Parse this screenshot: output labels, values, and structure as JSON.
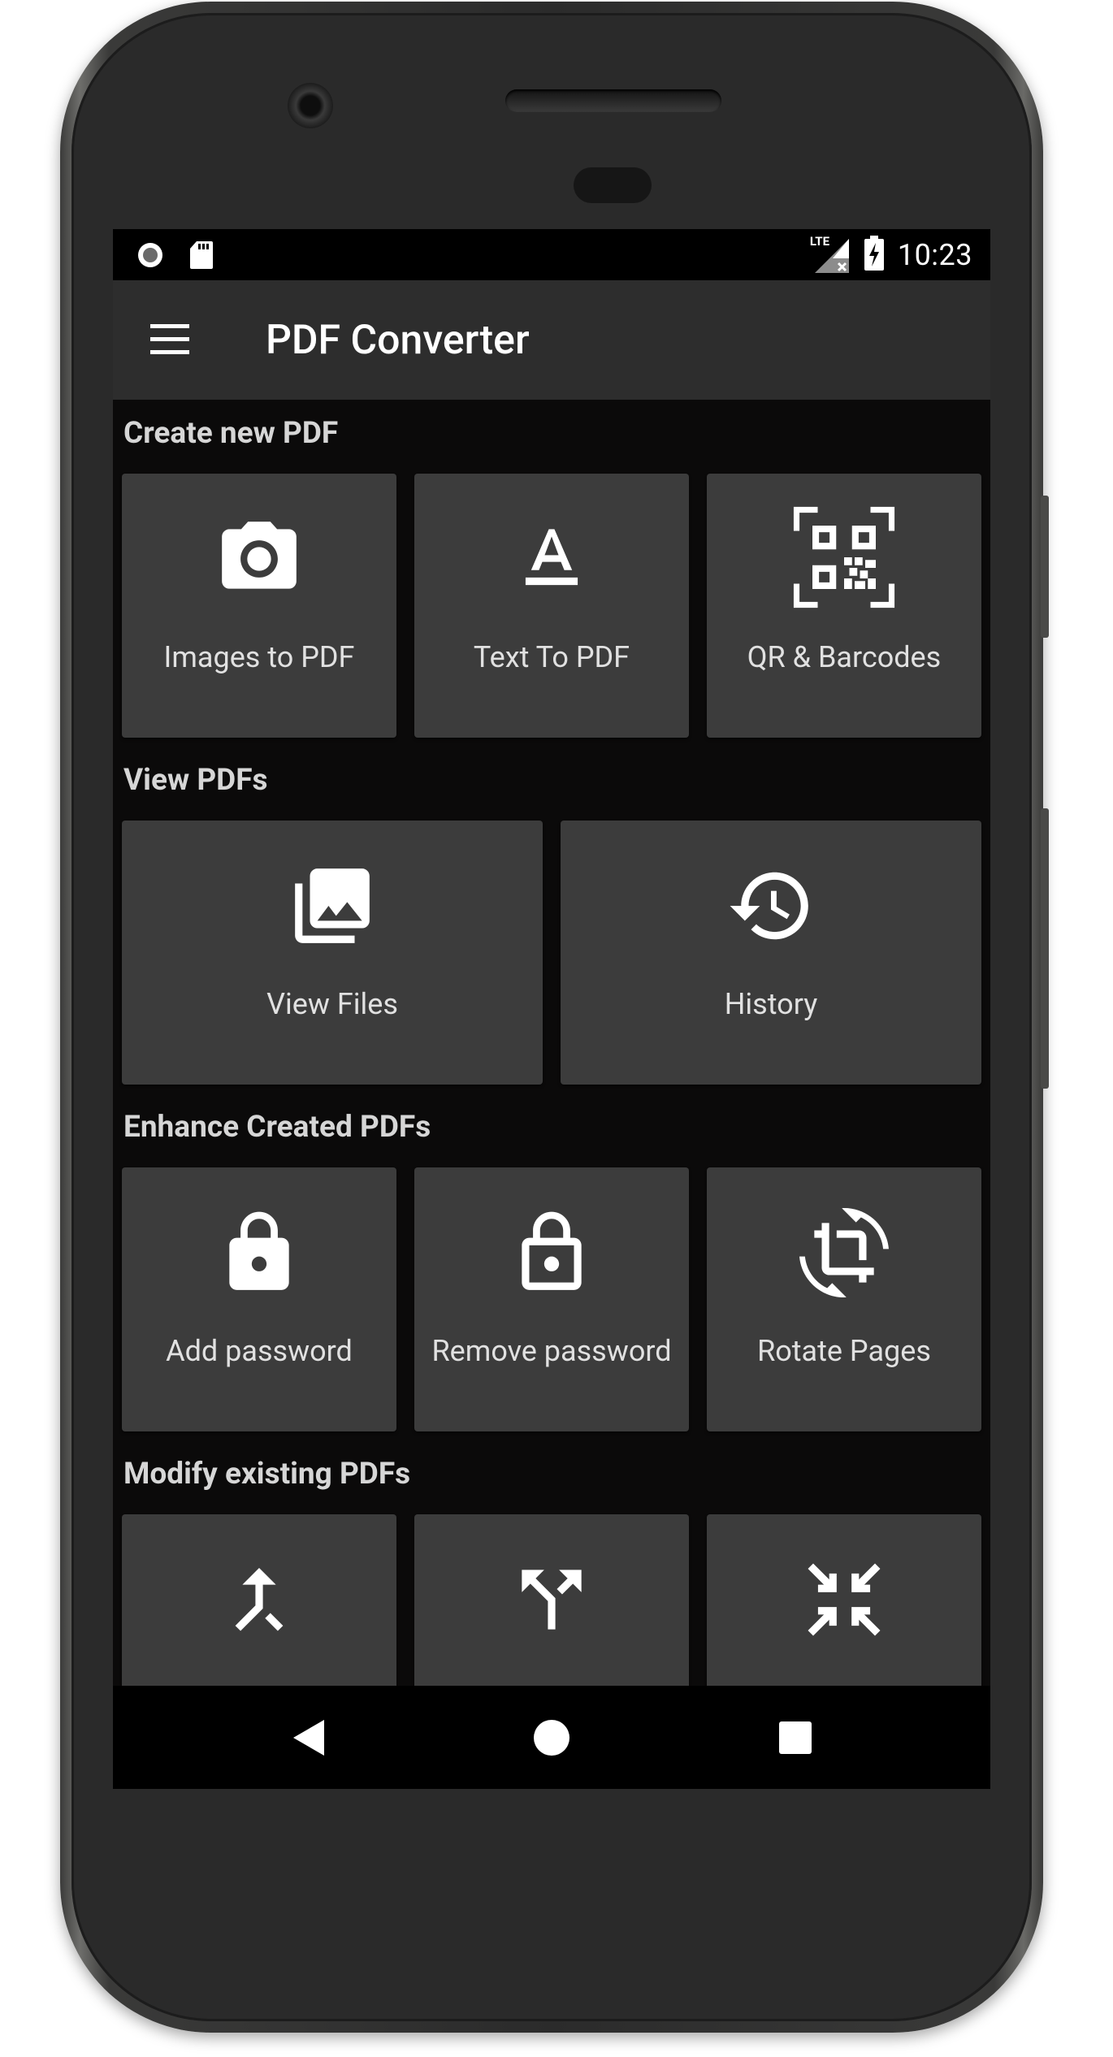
{
  "status_bar": {
    "time": "10:23",
    "network_label": "LTE",
    "icons": [
      "record-icon",
      "sd-card-icon",
      "lte-signal-icon",
      "battery-charging-icon"
    ]
  },
  "app_bar": {
    "title": "PDF Converter",
    "menu_icon": "hamburger-menu-icon"
  },
  "sections": {
    "create": {
      "title": "Create new PDF",
      "items": [
        {
          "label": "Images to PDF",
          "icon": "camera-icon"
        },
        {
          "label": "Text To PDF",
          "icon": "text-format-icon"
        },
        {
          "label": "QR & Barcodes",
          "icon": "qr-scan-icon"
        }
      ]
    },
    "view": {
      "title": "View PDFs",
      "items": [
        {
          "label": "View Files",
          "icon": "photo-library-icon"
        },
        {
          "label": "History",
          "icon": "history-icon"
        }
      ]
    },
    "enhance": {
      "title": "Enhance Created PDFs",
      "items": [
        {
          "label": "Add password",
          "icon": "lock-icon"
        },
        {
          "label": "Remove password",
          "icon": "lock-open-icon"
        },
        {
          "label": "Rotate Pages",
          "icon": "crop-rotate-icon"
        }
      ]
    },
    "modify": {
      "title": "Modify existing PDFs",
      "items": [
        {
          "icon": "merge-icon"
        },
        {
          "icon": "split-icon"
        },
        {
          "icon": "compress-icon"
        }
      ]
    }
  },
  "nav_bar": {
    "icons": [
      "back-icon",
      "home-icon",
      "recents-icon"
    ]
  },
  "colors": {
    "screen_bg": "#0b0a0a",
    "app_bar": "#2d2d2d",
    "card": "#3c3c3c",
    "text": "#e1e1e1"
  }
}
